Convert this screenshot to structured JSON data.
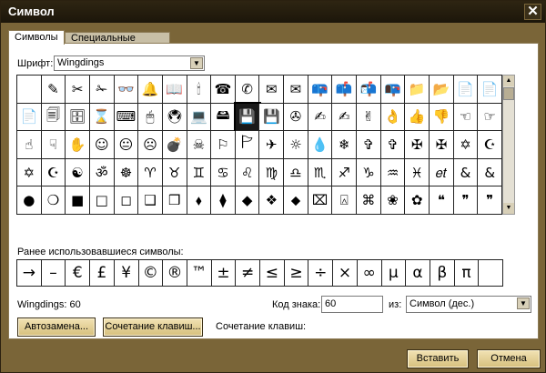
{
  "window": {
    "title": "Символ",
    "close_glyph": "✕"
  },
  "tabs": [
    {
      "label": "Символы",
      "active": true
    },
    {
      "label": "Специальные знаки",
      "active": false
    }
  ],
  "font": {
    "label": "Шрифт:",
    "value": "Wingdings"
  },
  "symbol_grid": {
    "rows": [
      [
        " ",
        "✎",
        "✂",
        "✁",
        "👓",
        "🔔",
        "📖",
        "🕯",
        "☎",
        "✆",
        "✉",
        "✉",
        "📪",
        "📫",
        "📬",
        "📭",
        "📁",
        "📂",
        "📄",
        "📄"
      ],
      [
        "📄",
        "🗐",
        "🗄",
        "⌛",
        "⌨",
        "🖱",
        "🖲",
        "💻",
        "🖴",
        "💾",
        "💾",
        "✇",
        "✍",
        "✍",
        "✌",
        "👌",
        "👍",
        "👎",
        "☜",
        "☞"
      ],
      [
        "☝",
        "☟",
        "✋",
        "☺",
        "😐",
        "☹",
        "💣",
        "☠",
        "⚐",
        "🏱",
        "✈",
        "☼",
        "💧",
        "❄",
        "✞",
        "✞",
        "✠",
        "✠",
        "✡",
        "☪"
      ],
      [
        "✡",
        "☪",
        "☯",
        "ॐ",
        "☸",
        "♈",
        "♉",
        "♊",
        "♋",
        "♌",
        "♍",
        "♎",
        "♏",
        "♐",
        "♑",
        "♒",
        "♓",
        "𝑒𝑡",
        "&",
        "&"
      ],
      [
        "●",
        "❍",
        "■",
        "□",
        "◻",
        "❑",
        "❒",
        "⬧",
        "⧫",
        "◆",
        "❖",
        "⬥",
        "⌧",
        "⍓",
        "⌘",
        "❀",
        "✿",
        "❝",
        "❞",
        "❞"
      ]
    ],
    "selected_row": 1,
    "selected_col": 9
  },
  "recent": {
    "label": "Ранее использовавшиеся символы:",
    "symbols": [
      "→",
      "–",
      "€",
      "£",
      "¥",
      "©",
      "®",
      "™",
      "±",
      "≠",
      "≤",
      "≥",
      "÷",
      "×",
      "∞",
      "µ",
      "α",
      "β",
      "π",
      ""
    ]
  },
  "char_info": "Wingdings: 60",
  "code": {
    "label": "Код знака:",
    "value": "60"
  },
  "from": {
    "label": "из:",
    "value": "Символ (дес.)"
  },
  "buttons": {
    "autocorrect": "Автозамена...",
    "shortcut": "Сочетание клавиш...",
    "insert": "Вставить",
    "cancel": "Отмена"
  },
  "shortcut_text": "Сочетание клавиш:"
}
